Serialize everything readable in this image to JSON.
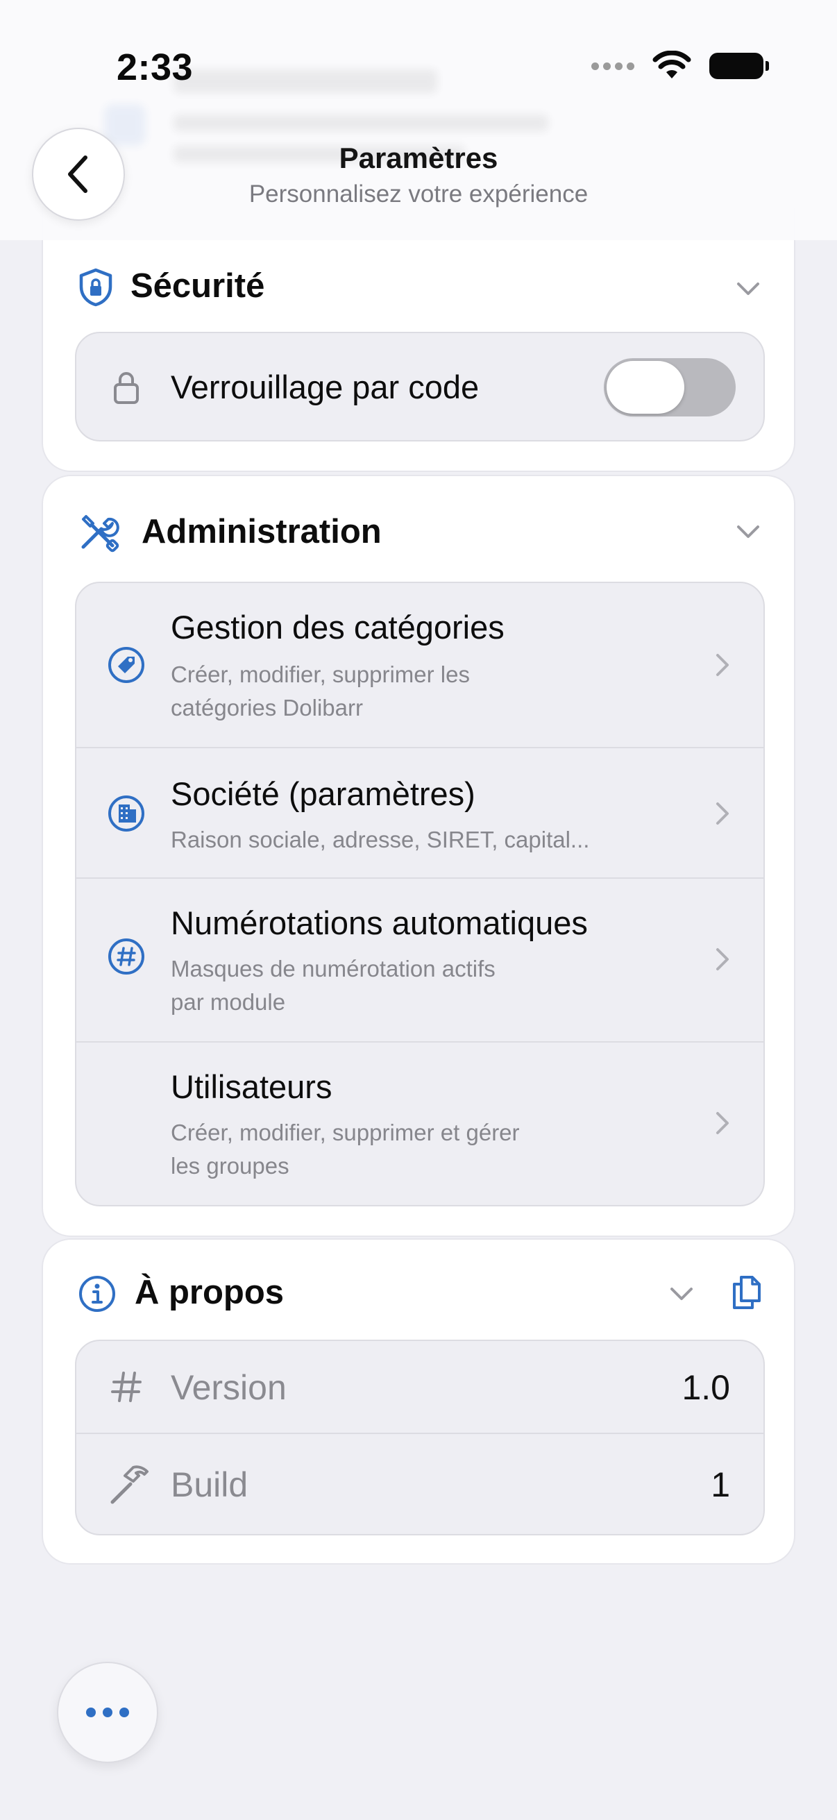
{
  "status_bar": {
    "time": "2:33"
  },
  "header": {
    "title": "Paramètres",
    "subtitle": "Personnalisez votre expérience"
  },
  "security": {
    "title": "Sécurité",
    "items": [
      {
        "label": "Verrouillage par code",
        "toggle_on": false
      }
    ]
  },
  "administration": {
    "title": "Administration",
    "items": [
      {
        "title": "Gestion des catégories",
        "subtitle_line1": "Créer, modifier, supprimer les",
        "subtitle_line2": "catégories Dolibarr",
        "icon": "tag-icon"
      },
      {
        "title": "Société (paramètres)",
        "subtitle_line1": "Raison sociale, adresse, SIRET, capital...",
        "icon": "building-icon"
      },
      {
        "title": "Numérotations automatiques",
        "subtitle_line1": "Masques de numérotation actifs",
        "subtitle_line2": "par module",
        "icon": "hash-icon"
      },
      {
        "title": "Utilisateurs",
        "subtitle_line1": "Créer, modifier, supprimer et gérer",
        "subtitle_line2": "les groupes",
        "icon": "users-icon"
      }
    ]
  },
  "about": {
    "title": "À propos",
    "rows": [
      {
        "label": "Version",
        "value": "1.0"
      },
      {
        "label": "Build",
        "value": "1"
      }
    ]
  },
  "colors": {
    "accent": "#2f6fc4",
    "background": "#f0f0f5",
    "card": "#ffffff"
  }
}
